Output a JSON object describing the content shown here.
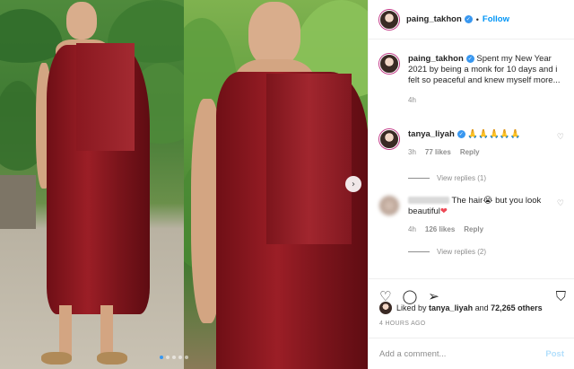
{
  "post": {
    "author": "paing_takhon",
    "follow_label": "Follow",
    "separator": "•",
    "verified_glyph": "✓",
    "slide_next_glyph": "›",
    "caption": {
      "author": "paing_takhon",
      "text": "Spent my New Year 2021 by being a monk for 10 days and i felt so peaceful and knew myself more...",
      "time": "4h"
    },
    "comments": [
      {
        "author": "tanya_liyah",
        "text": "🙏🙏🙏🙏🙏",
        "time": "3h",
        "likes": "77 likes",
        "reply_label": "Reply",
        "view_replies": "View replies (1)"
      },
      {
        "author_hidden": true,
        "text_before": "The hair",
        "emoji": "😭",
        "text_after": " but you look beautiful",
        "heart": "❤",
        "time": "4h",
        "likes": "126 likes",
        "reply_label": "Reply",
        "view_replies": "View replies (2)"
      }
    ],
    "liked_by": {
      "prefix": "Liked by",
      "user": "tanya_liyah",
      "conjunction": "and",
      "others": "72,265 others"
    },
    "timestamp": "4 HOURS AGO",
    "add_comment": {
      "placeholder": "Add a comment...",
      "post_label": "Post"
    },
    "icons": {
      "like": "♡",
      "comment": "◯",
      "share": "➢",
      "bookmark": "⛉",
      "comment_like": "♡"
    },
    "carousel": {
      "slides": 5,
      "active_index": 0
    }
  },
  "colors": {
    "accent": "#0095f6",
    "verified": "#3897f0",
    "muted": "#8e8e8e",
    "robe": "#8b1a22",
    "heart": "#ed4956"
  }
}
